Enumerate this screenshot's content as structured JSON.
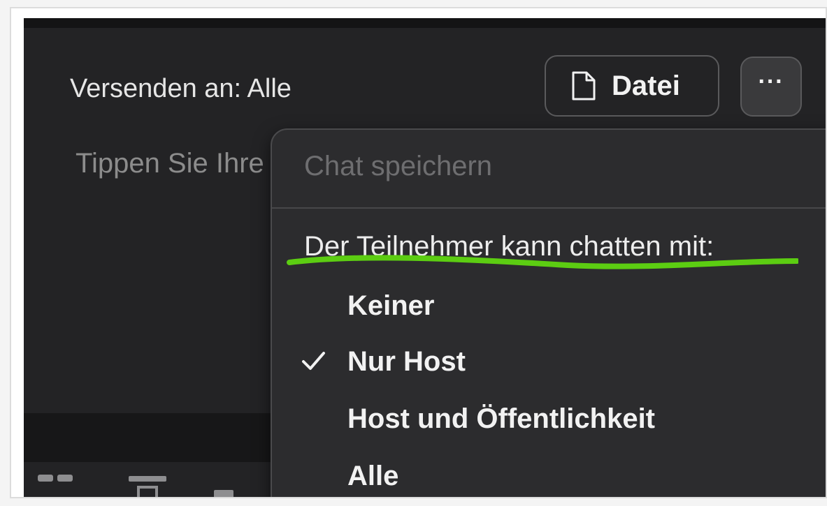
{
  "chat": {
    "send_to_label": "Versenden an: Alle",
    "file_button_label": "Datei",
    "more_button_label": "···",
    "message_placeholder": "Tippen Sie Ihre Nachricht hier ein ..."
  },
  "menu": {
    "save_chat_label": "Chat speichern",
    "section_title": "Der Teilnehmer kann chatten mit:",
    "options": [
      {
        "label": "Keiner",
        "checked": false
      },
      {
        "label": "Nur Host",
        "checked": true
      },
      {
        "label": "Host und Öffentlichkeit",
        "checked": false
      },
      {
        "label": "Alle",
        "checked": false
      }
    ]
  },
  "icons": {
    "file": "file-icon",
    "more": "ellipsis-icon",
    "check": "checkmark-icon"
  },
  "colors": {
    "background": "#232325",
    "menu_background": "#2c2c2e",
    "highlight_underline": "#5ccd12",
    "disabled_text": "#6e6e70"
  }
}
